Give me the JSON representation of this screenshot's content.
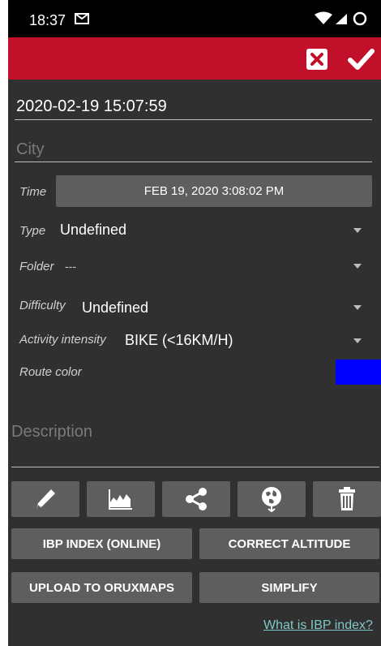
{
  "status_bar": {
    "time": "18:37"
  },
  "track": {
    "name": "2020-02-19 15:07:59",
    "city_placeholder": "City"
  },
  "fields": {
    "time": {
      "label": "Time",
      "value": "FEB 19, 2020 3:08:02 PM"
    },
    "type": {
      "label": "Type",
      "value": "Undefined"
    },
    "folder": {
      "label": "Folder",
      "value": "---"
    },
    "difficulty": {
      "label": "Difficulty",
      "value": "Undefined"
    },
    "activity": {
      "label": "Activity intensity",
      "value": "BIKE (<16KM/H)"
    },
    "route_color": {
      "label": "Route color",
      "color": "#0000ff"
    }
  },
  "description": {
    "placeholder": "Description"
  },
  "icon_buttons": [
    "edit-pencil-icon",
    "altitude-chart-icon",
    "share-icon",
    "globe-upload-icon",
    "trash-icon"
  ],
  "buttons": {
    "ibp": "IBP INDEX (ONLINE)",
    "correct_altitude": "CORRECT ALTITUDE",
    "upload": "UPLOAD TO ORUXMAPS",
    "simplify": "SIMPLIFY"
  },
  "link": {
    "text": "What is IBP index?"
  },
  "colors": {
    "toolbar": "#c0102a",
    "background": "#303030",
    "button": "#5e5e5e",
    "link": "#7ec9c4"
  }
}
